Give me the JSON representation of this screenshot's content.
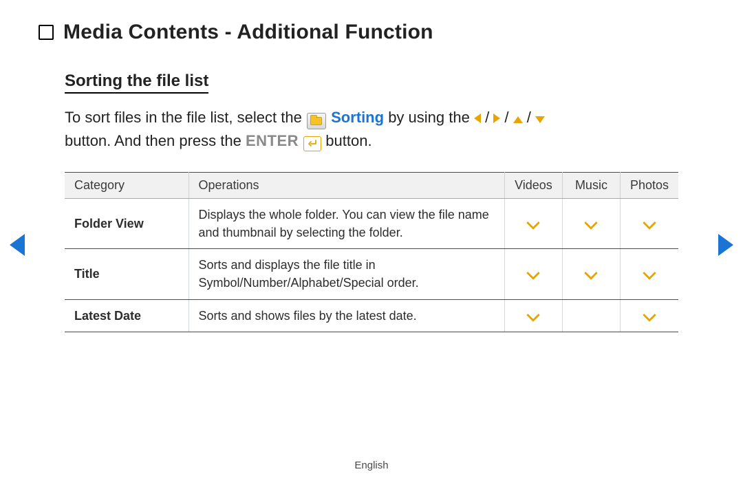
{
  "title": "Media Contents - Additional Function",
  "subheading": "Sorting the file list",
  "intro": {
    "part1": "To sort files in the file list, select the ",
    "sorting_label": "Sorting",
    "part2_a": " by using the ",
    "sep": " / ",
    "part3a": "button. And then press the ",
    "enter_label": "ENTER",
    "part3b": " button."
  },
  "columns": {
    "category": "Category",
    "operations": "Operations",
    "videos": "Videos",
    "music": "Music",
    "photos": "Photos"
  },
  "rows": [
    {
      "category": "Folder View",
      "operation": "Displays the whole folder. You can view the file name and thumbnail by selecting the folder.",
      "videos": true,
      "music": true,
      "photos": true
    },
    {
      "category": "Title",
      "operation": "Sorts and displays the file title in Symbol/Number/Alphabet/Special order.",
      "videos": true,
      "music": true,
      "photos": true
    },
    {
      "category": "Latest Date",
      "operation": "Sorts and shows files by the latest date.",
      "videos": true,
      "music": false,
      "photos": true
    }
  ],
  "footer_language": "English"
}
